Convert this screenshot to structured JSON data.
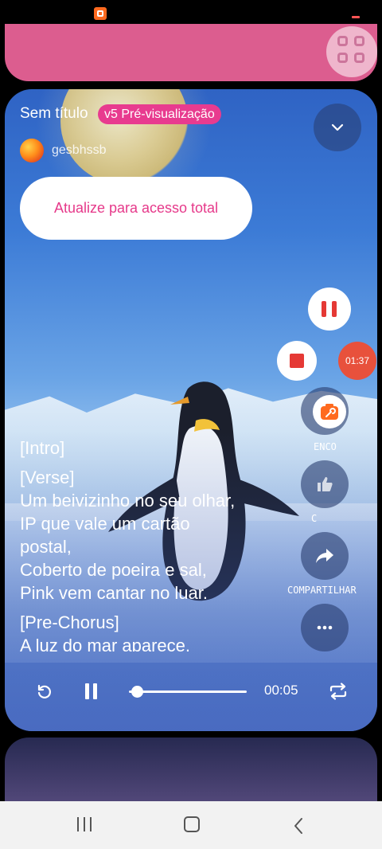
{
  "status_bar": {
    "app_icon": "app-notification-icon"
  },
  "floating_menu": {
    "icon": "grid-icon"
  },
  "player": {
    "title": "Sem título",
    "version_badge": "v5 Pré-visualização",
    "username": "gesbhssb",
    "upgrade_button": "Atualize para acesso total",
    "lyrics": {
      "intro": "[Intro]",
      "verse_tag": "[Verse]",
      "verse_lines": [
        "Um beivizinho no seu olhar,",
        "IP que vale um cartão",
        "postal,",
        "Coberto de poeira e sal,",
        "Pink vem cantar no luar."
      ],
      "pre_chorus_tag": "[Pre-Chorus]",
      "cut_line": "A luz do mar aparece,"
    },
    "side_actions": {
      "silence_label": "ENCO",
      "like_label": "C",
      "share_label": "COMPARTILHAR"
    },
    "controls": {
      "elapsed": "00:05",
      "progress": 0.07
    }
  },
  "recorder": {
    "time": "01:37"
  },
  "colors": {
    "accent_pink": "#e83b8f",
    "record_red": "#e53935",
    "record_orange": "#e8513c"
  }
}
